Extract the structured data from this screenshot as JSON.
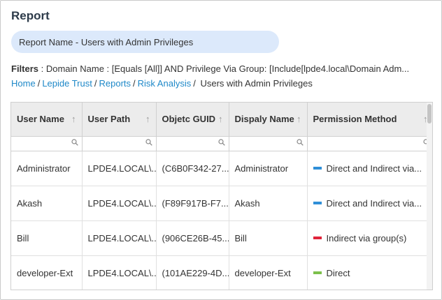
{
  "page": {
    "title": "Report"
  },
  "report": {
    "name_label": "Report Name - Users with Admin Privileges"
  },
  "filters": {
    "label": "Filters",
    "text": " : Domain Name : [Equals [All]] AND Privilege Via Group: [Include[lpde4.local\\Domain Adm..."
  },
  "breadcrumb": {
    "items": [
      "Home",
      "Lepide Trust",
      "Reports",
      "Risk Analysis"
    ],
    "current": "Users with Admin Privileges"
  },
  "grid": {
    "columns": [
      "User Name",
      "User Path",
      "Objetc GUID",
      "Dispaly Name",
      "Permission Method"
    ],
    "rows": [
      {
        "user": "Administrator",
        "path": "LPDE4.LOCAL\\...",
        "guid": "(C6B0F342-27...",
        "display": "Administrator",
        "method": "Direct and Indirect via...",
        "color": "#2f8fd8"
      },
      {
        "user": "Akash",
        "path": "LPDE4.LOCAL\\...",
        "guid": "(F89F917B-F7...",
        "display": "Akash",
        "method": "Direct and Indirect via...",
        "color": "#2f8fd8"
      },
      {
        "user": "Bill",
        "path": "LPDE4.LOCAL\\...",
        "guid": "(906CE26B-45...",
        "display": "Bill",
        "method": "Indirect via group(s)",
        "color": "#e0243b"
      },
      {
        "user": "developer-Ext",
        "path": "LPDE4.LOCAL\\...",
        "guid": "(101AE229-4D...",
        "display": "developer-Ext",
        "method": "Direct",
        "color": "#7cc04b"
      }
    ]
  },
  "icons": {
    "sort": "sort-arrow-icon",
    "filter": "magnifier-icon"
  }
}
